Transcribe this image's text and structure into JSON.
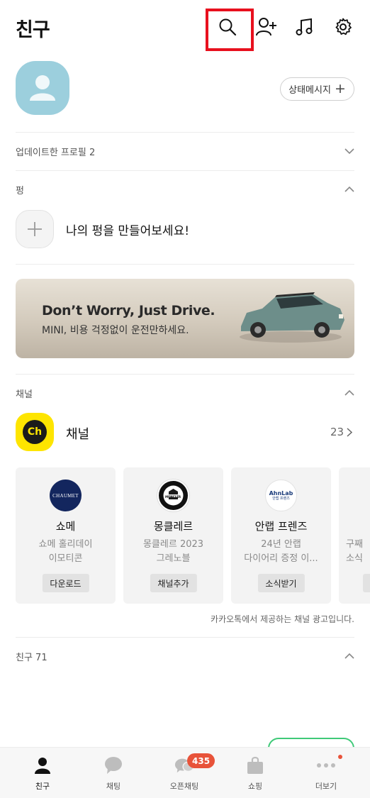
{
  "header": {
    "title": "친구",
    "icons": [
      "search-icon",
      "add-friend-icon",
      "music-icon",
      "settings-icon"
    ]
  },
  "profile": {
    "status_button_label": "상태메시지",
    "status_button_icon": "plus-icon"
  },
  "sections": {
    "updated_profiles": "업데이트한 프로필 2",
    "peng": "펑",
    "channel": "채널",
    "friends": "친구 71"
  },
  "peng": {
    "create_label": "나의 펑을 만들어보세요!"
  },
  "ad_banner": {
    "headline": "Don’t Worry, Just Drive.",
    "subtext": "MINI, 비용 걱정없이 운전만하세요."
  },
  "channel": {
    "title": "채널",
    "logo_text": "Ch",
    "count": "23",
    "cards": [
      {
        "name": "쇼메",
        "desc_line1": "쇼메 홀리데이",
        "desc_line2": "이모티콘",
        "button": "다운로드",
        "logo_text": "CHAUMET"
      },
      {
        "name": "몽클레르",
        "desc_line1": "몽클레르 2023",
        "desc_line2": "그레노블",
        "button": "채널추가",
        "logo_text": "MONCLER"
      },
      {
        "name": "안랩 프렌즈",
        "desc_line1": "24년 안랩",
        "desc_line2": "다이어리 증정 이...",
        "button": "소식받기",
        "logo_text": "AhnLab",
        "logo_sub": "안랩 프렌즈"
      },
      {
        "name": "",
        "desc_line1": "구째",
        "desc_line2": "소식",
        "button": ""
      }
    ],
    "ad_note": "카카오톡에서 제공하는 채널 광고입니다."
  },
  "tabbar": {
    "tabs": [
      {
        "label": "친구",
        "icon": "person-icon",
        "active": true
      },
      {
        "label": "채팅",
        "icon": "chat-bubble-icon",
        "active": false
      },
      {
        "label": "오픈채팅",
        "icon": "open-chat-icon",
        "active": false
      },
      {
        "label": "쇼핑",
        "icon": "shopping-bag-icon",
        "active": false
      },
      {
        "label": "더보기",
        "icon": "more-icon",
        "active": false
      }
    ],
    "open_chat_badge": "435"
  },
  "colors": {
    "accent_yellow": "#fee500",
    "badge_red": "#e8533a",
    "highlight_red": "#e8101e",
    "avatar_blue": "#9ccfdd"
  }
}
